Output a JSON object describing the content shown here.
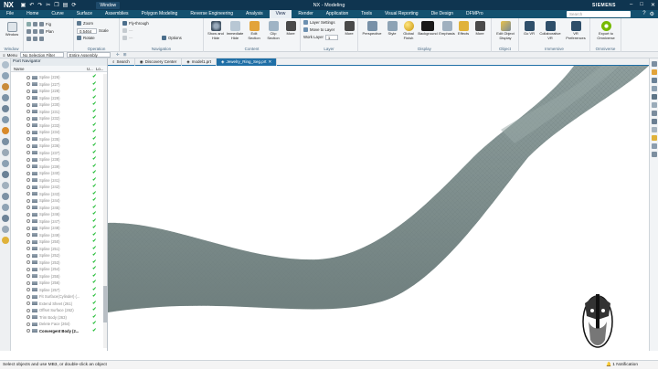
{
  "app": {
    "logo": "NX",
    "window_menu": "Window",
    "title": "NX - Modeling",
    "brand": "SIEMENS"
  },
  "menu": {
    "tabs": [
      "File",
      "Home",
      "Curve",
      "Surface",
      "Assemblies",
      "Polygon Modeling",
      "Reverse Engineering",
      "Analysis",
      "View",
      "Render",
      "Application",
      "Tools",
      "Visual Reporting",
      "Die Design",
      "DFMPro"
    ],
    "active_tab": "View",
    "search_placeholder": "Search"
  },
  "ribbon": {
    "window_group": {
      "label": "Window",
      "buttons": [
        "Window",
        "Fig",
        "Plan"
      ]
    },
    "operation_group": {
      "label": "Operation",
      "zoom_label": "Zoom",
      "zoom_value": "0.5464",
      "scale_label": "Scale",
      "rotate_label": "Rotate"
    },
    "navigation_group": {
      "label": "Navigation",
      "items": [
        "Fly-through",
        "Options"
      ]
    },
    "content_group": {
      "label": "Content",
      "buttons": [
        "Show and Hide",
        "Immediate Hide",
        "Edit Section",
        "Clip Section",
        "More"
      ]
    },
    "layer_group": {
      "label": "Layer",
      "items": [
        "Layer Settings",
        "Move to Layer",
        "Work Layer"
      ],
      "work_layer_value": "1",
      "more": "More"
    },
    "display_group": {
      "label": "Display",
      "buttons": [
        "Perspective",
        "Style",
        "Global Finish",
        "Background",
        "Emphasis",
        "Effects",
        "More"
      ]
    },
    "object_group": {
      "label": "Object",
      "buttons": [
        "Edit Object Display"
      ]
    },
    "immersive_group": {
      "label": "Immersive",
      "buttons": [
        "Go VR",
        "Collaborative VR",
        "VR Preferences"
      ]
    },
    "omniverse_group": {
      "label": "Omniverse",
      "buttons": [
        "Export to Omniverse"
      ]
    }
  },
  "selection_bar": {
    "menu": "Menu",
    "filter": "No Selection Filter",
    "scope": "Entire Assembly"
  },
  "navigator": {
    "title": "Part Navigator",
    "columns": [
      "Name",
      "U...",
      "Lo..."
    ],
    "rows": [
      "Spline (226)",
      "Spline (227)",
      "Spline (228)",
      "Spline (229)",
      "Spline (230)",
      "Spline (231)",
      "Spline (232)",
      "Spline (233)",
      "Spline (234)",
      "Spline (235)",
      "Spline (236)",
      "Spline (237)",
      "Spline (238)",
      "Spline (239)",
      "Spline (240)",
      "Spline (241)",
      "Spline (242)",
      "Spline (243)",
      "Spline (244)",
      "Spline (245)",
      "Spline (246)",
      "Spline (247)",
      "Spline (248)",
      "Spline (249)",
      "Spline (250)",
      "Spline (251)",
      "Spline (252)",
      "Spline (253)",
      "Spline (254)",
      "Spline (255)",
      "Spline (256)",
      "Spline (257)",
      "Fit Surface(Cylinder) (...",
      "Extend Sheet (261)",
      "Offset Surface (262)",
      "Trim Body (263)",
      "Delete Face (264)",
      "Convergent Body (2..."
    ]
  },
  "file_tabs": [
    "Search",
    "Discovery Center",
    "model1.prt",
    "Jewelry_Ring_Seg.prt"
  ],
  "active_file_tab": "Jewelry_Ring_Seg.prt",
  "status": {
    "message": "Select objects and use MB3, or double-click an object",
    "notifications": "1 Notification"
  },
  "colors": {
    "titlebar": "#0f3550",
    "menubar": "#13516f",
    "model_surface": "#7f8f8e",
    "check": "#2bbf3d"
  }
}
